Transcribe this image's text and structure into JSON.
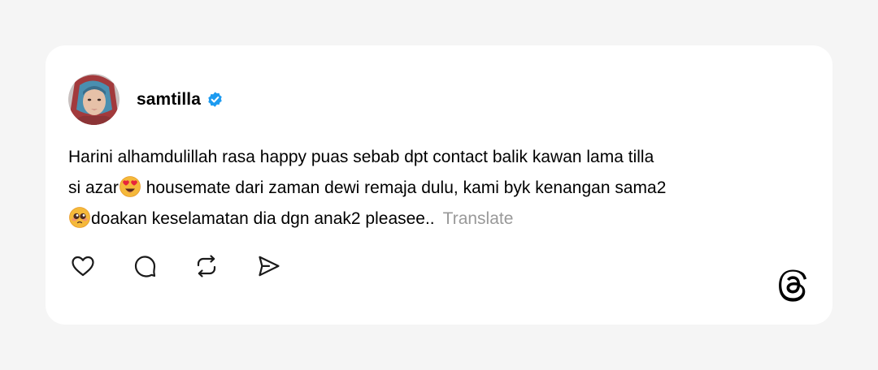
{
  "post": {
    "author": {
      "username": "samtilla",
      "verified": true
    },
    "text": {
      "line1": "Harini alhamdulillah rasa happy puas sebab dpt contact balik kawan lama tilla",
      "line2_prefix": "si azar",
      "line2_suffix": " housemate dari zaman dewi remaja dulu, kami byk kenangan sama2",
      "line3": "doakan keselamatan dia dgn anak2 pleasee..",
      "emoji_1": "smiling-face-with-heart-eyes",
      "emoji_2": "pleading-face"
    },
    "translate_label": "Translate",
    "actions": [
      "heart-icon",
      "comment-icon",
      "repost-icon",
      "share-icon"
    ]
  },
  "brand": {
    "logo": "threads-logo-icon",
    "verified_color": "#1d9bf0"
  }
}
